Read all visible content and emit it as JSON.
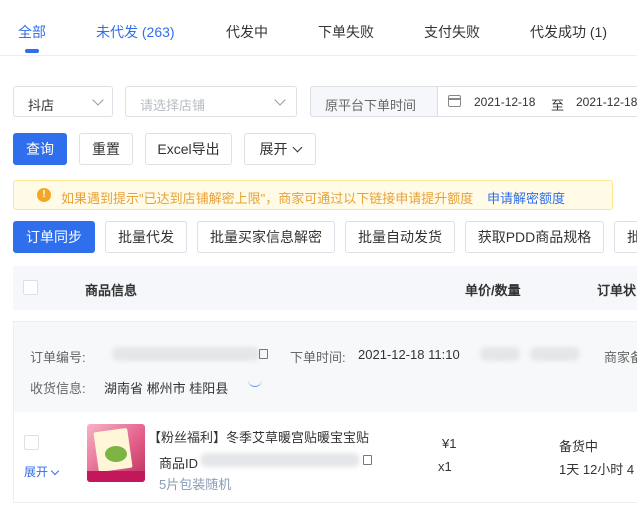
{
  "tabs": [
    {
      "label": "全部"
    },
    {
      "label": "未代发 (263)"
    },
    {
      "label": "代发中"
    },
    {
      "label": "下单失败"
    },
    {
      "label": "支付失败"
    },
    {
      "label": "代发成功 (1)"
    }
  ],
  "filters": {
    "platform_value": "抖店",
    "shop_placeholder": "请选择店铺",
    "time_type_label": "原平台下单时间",
    "date_start": "2021-12-18",
    "date_separator": "至",
    "date_end": "2021-12-18"
  },
  "actions": {
    "query": "查询",
    "reset": "重置",
    "excel_export": "Excel导出",
    "expand": "展开"
  },
  "notice": {
    "icon_symbol": "!",
    "text": "如果遇到提示\"已达到店铺解密上限\"，商家可通过以下链接申请提升额度",
    "link": "申请解密额度"
  },
  "toolbar": {
    "buttons": [
      "订单同步",
      "批量代发",
      "批量买家信息解密",
      "批量自动发货",
      "获取PDD商品规格",
      "批"
    ]
  },
  "table": {
    "headers": {
      "product_info": "商品信息",
      "price_qty": "单价/数量",
      "order_status": "订单状"
    }
  },
  "order": {
    "order_no_label": "订单编号:",
    "order_time_label": "下单时间:",
    "order_time_value": "2021-12-18 11:10",
    "merchant_label": "商家备",
    "address_label": "收货信息:",
    "address_value": "湖南省 郴州市 桂阳县",
    "expand_label": "展开",
    "product_title": "【粉丝福利】冬季艾草暖宫贴暖宝宝贴",
    "product_id_label": "商品ID",
    "product_spec": "5片包装随机",
    "price": "¥1",
    "quantity": "x1",
    "status": "备货中",
    "countdown": "1天 12小时 4"
  },
  "colors": {
    "primary": "#2f6fed",
    "warning": "#e6a23c",
    "notice_bg": "#fffbe6"
  }
}
